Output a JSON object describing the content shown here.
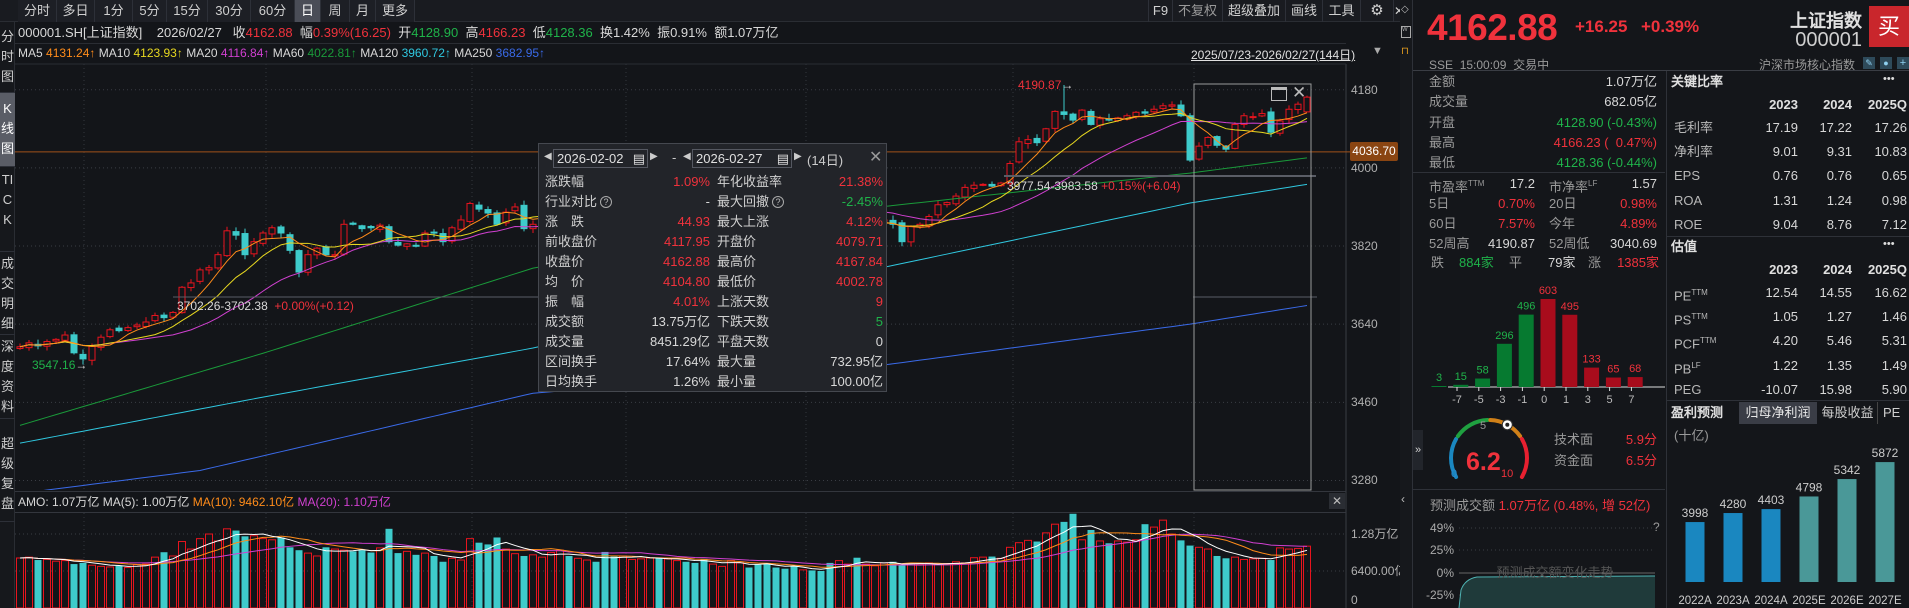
{
  "toolbar": {
    "tabs": [
      "分时",
      "多日",
      "1分",
      "5分",
      "15分",
      "30分",
      "60分",
      "日",
      "周",
      "月",
      "更多"
    ],
    "active_tab": "日",
    "right": [
      "F9",
      "不复权",
      "超级叠加",
      "画线",
      "工具"
    ]
  },
  "left_tabs": [
    "分时图",
    "K线图",
    "TICK",
    "成交明细",
    "深度资料",
    "超级复盘"
  ],
  "info": {
    "code": "000001.SH[上证指数]",
    "date": "2026/02/27",
    "close_label": "收",
    "close": "4162.88",
    "chg_label": "幅",
    "chg": "0.39%(16.25)",
    "open_label": "开",
    "open": "4128.90",
    "high_label": "高",
    "high": "4166.23",
    "low_label": "低",
    "low": "4128.36",
    "turnover": "换1.42%",
    "amplitude": "振0.91%",
    "amount": "额1.07万亿"
  },
  "ma": [
    {
      "label": "MA5",
      "value": "4131.24↑",
      "color": "#ff8c1a"
    },
    {
      "label": "MA10",
      "value": "4123.93↑",
      "color": "#e8d820"
    },
    {
      "label": "MA20",
      "value": "4116.84↑",
      "color": "#d040d0"
    },
    {
      "label": "MA60",
      "value": "4022.81↑",
      "color": "#1a9a3a"
    },
    {
      "label": "MA120",
      "value": "3960.72↑",
      "color": "#30c8e0"
    },
    {
      "label": "MA250",
      "value": "3682.95↑",
      "color": "#3a6ae8"
    }
  ],
  "date_range": "2025/07/23-2026/02/27(144日)",
  "price_axis": {
    "ticks": [
      4180,
      4000,
      3820,
      3640,
      3460,
      3280
    ],
    "ref_line": "4036.70"
  },
  "annotations": {
    "high_label": "4190.87",
    "low_label": "3547.16",
    "measure1": {
      "range": "3702.26-3702.38",
      "chg": "+0.00%(+0.12)"
    },
    "measure2": {
      "range": "3977.54-3983.58",
      "chg": "+0.15%(+6.04)"
    }
  },
  "tooltip": {
    "start": "2026-02-02",
    "end": "2026-02-27",
    "sep": "-",
    "days": "(14日)",
    "rows": [
      {
        "l": "涨跌幅",
        "v": "1.09%",
        "c": "red",
        "l2": "年化收益率",
        "v2": "21.38%",
        "c2": "red"
      },
      {
        "l": "行业对比",
        "h": true,
        "v": "-",
        "c": "white",
        "l2": "最大回撤",
        "h2": true,
        "v2": "-2.45%",
        "c2": "green"
      },
      {
        "l": "涨　跌",
        "v": "44.93",
        "c": "red",
        "l2": "最大上涨",
        "v2": "4.12%",
        "c2": "red"
      },
      {
        "l": "前收盘价",
        "v": "4117.95",
        "c": "red",
        "l2": "开盘价",
        "v2": "4079.71",
        "c2": "red"
      },
      {
        "l": "收盘价",
        "v": "4162.88",
        "c": "red",
        "l2": "最高价",
        "v2": "4167.84",
        "c2": "red"
      },
      {
        "l": "均　价",
        "v": "4104.80",
        "c": "red",
        "l2": "最低价",
        "v2": "4002.78",
        "c2": "red"
      },
      {
        "l": "振　幅",
        "v": "4.01%",
        "c": "red",
        "l2": "上涨天数",
        "v2": "9",
        "c2": "red"
      },
      {
        "l": "成交额",
        "v": "13.75万亿",
        "c": "white",
        "l2": "下跌天数",
        "v2": "5",
        "c2": "green"
      },
      {
        "l": "成交量",
        "v": "8451.29亿",
        "c": "white",
        "l2": "平盘天数",
        "v2": "0",
        "c2": "white"
      },
      {
        "l": "区间换手",
        "v": "17.64%",
        "c": "white",
        "l2": "最大量",
        "v2": "732.95亿",
        "c2": "white"
      },
      {
        "l": "日均换手",
        "v": "1.26%",
        "c": "white",
        "l2": "最小量",
        "v2": "100.00亿",
        "c2": "white"
      }
    ]
  },
  "volume": {
    "amo": "AMO: 1.07万亿",
    "ma5": "MA(5): 1.00万亿",
    "ma10": "MA(10): 9462.10亿",
    "ma20": "MA(20): 1.10万亿",
    "ticks": [
      "1.28万亿",
      "6400.00亿",
      "0"
    ]
  },
  "kline": {
    "closes": [
      3588,
      3597,
      3590,
      3600,
      3605,
      3615,
      3574,
      3560,
      3589,
      3610,
      3627,
      3625,
      3632,
      3638,
      3645,
      3660,
      3655,
      3667,
      3725,
      3735,
      3765,
      3770,
      3800,
      3855,
      3845,
      3800,
      3830,
      3850,
      3862,
      3850,
      3810,
      3760,
      3800,
      3815,
      3800,
      3800,
      3870,
      3870,
      3860,
      3862,
      3868,
      3830,
      3822,
      3825,
      3820,
      3850,
      3850,
      3830,
      3862,
      3880,
      3918,
      3905,
      3896,
      3870,
      3898,
      3910,
      3860,
      3870,
      3882,
      3890,
      3900,
      3895,
      3905,
      3910,
      3898,
      3888,
      3880,
      3892,
      3902,
      3915,
      3925,
      3918,
      3930,
      3940,
      3935,
      3925,
      3912,
      3920,
      3932,
      3945,
      3950,
      3938,
      3925,
      3915,
      3905,
      3898,
      3890,
      3900,
      3885,
      3870,
      3860,
      3868,
      3875,
      3862,
      3870,
      3878,
      3880,
      3870,
      3830,
      3865,
      3870,
      3888,
      3915,
      3920,
      3935,
      3955,
      3960,
      3962,
      3958,
      3965,
      4010,
      4060,
      4065,
      4058,
      4090,
      4130,
      4123,
      4110,
      4133,
      4100,
      4113,
      4110,
      4115,
      4120,
      4128,
      4126,
      4135,
      4143,
      4145,
      4120,
      4018,
      4050,
      4070,
      4052,
      4043,
      4100,
      4120,
      4118,
      4125,
      4082,
      4108,
      4135,
      4146.63,
      4162.88
    ],
    "volumes": [
      8650,
      8800,
      8300,
      8400,
      8100,
      8200,
      7600,
      7800,
      7400,
      7200,
      7100,
      7300,
      7000,
      7500,
      7600,
      8800,
      9650,
      9000,
      11500,
      10200,
      12000,
      12800,
      11600,
      13700,
      13400,
      12400,
      12500,
      12000,
      11800,
      12200,
      10500,
      10000,
      9500,
      9000,
      10500,
      10200,
      10000,
      9800,
      10000,
      9600,
      10400,
      13700,
      9500,
      9800,
      9200,
      9500,
      9000,
      8000,
      8600,
      8300,
      12000,
      11300,
      11000,
      12200,
      10200,
      9400,
      9000,
      9200,
      8800,
      9600,
      10000,
      9000,
      8600,
      8300,
      8000,
      9700,
      8900,
      9000,
      8400,
      8500,
      8650,
      8600,
      8500,
      8200,
      8000,
      7800,
      8500,
      7600,
      7200,
      8200,
      7800,
      7000,
      7500,
      7800,
      7000,
      6800,
      7200,
      6600,
      6500,
      6400,
      7800,
      8200,
      7600,
      8700,
      7600,
      7300,
      7800,
      8000,
      7400,
      7700,
      7500,
      7800,
      7600,
      7700,
      8000,
      7800,
      8700,
      8800,
      8900,
      8600,
      10500,
      11300,
      11700,
      11500,
      13000,
      14500,
      14900,
      16300,
      11800,
      13500,
      11600,
      11200,
      11600,
      11400,
      11800,
      14500,
      14000,
      15200,
      12800,
      11700,
      10800,
      10500,
      10200,
      9000,
      8600,
      8800,
      8400,
      8500,
      8600,
      8300,
      10400,
      10200,
      10300,
      10700
    ],
    "last": {
      "open": 4128.9,
      "high": 4166.23,
      "low": 4128.36
    },
    "period_high": {
      "index": 116,
      "value": 4190.87
    },
    "period_low": {
      "index": 7,
      "value": 3547.16
    },
    "ma_long": {
      "ma60": [
        [
          0,
          3407
        ],
        [
          27,
          3573
        ],
        [
          57,
          3769
        ],
        [
          96,
          3911
        ],
        [
          130,
          3988
        ],
        [
          143,
          4023
        ]
      ],
      "ma120": [
        [
          0,
          3366
        ],
        [
          27,
          3472
        ],
        [
          57,
          3585
        ],
        [
          96,
          3771
        ],
        [
          130,
          3919
        ],
        [
          143,
          3962
        ]
      ],
      "ma250": [
        [
          0,
          3250
        ],
        [
          20,
          3303
        ],
        [
          57,
          3481
        ],
        [
          96,
          3546
        ],
        [
          130,
          3640
        ],
        [
          143,
          3683
        ]
      ]
    }
  },
  "quote": {
    "price": "4162.88",
    "change": "+16.25",
    "pct": "+0.39%",
    "name": "上证指数",
    "code": "000001",
    "buy": "买",
    "exchange": "SSE",
    "time": "15:00:09",
    "status": "交易中",
    "category": "沪深市场核心指数",
    "stats": [
      {
        "l": "金额",
        "v": "1.07万亿",
        "c": "white"
      },
      {
        "l": "成交量",
        "v": "682.05亿",
        "c": "white"
      },
      {
        "l": "开盘",
        "v": "4128.90 (-0.43%)",
        "c": "green"
      },
      {
        "l": "最高",
        "v": "4166.23 (  0.47%)",
        "c": "red"
      },
      {
        "l": "最低",
        "v": "4128.36 (-0.44%)",
        "c": "green"
      }
    ],
    "grid": [
      {
        "l": "市盈率",
        "sup": "TTM",
        "v": "17.2",
        "c": "white",
        "l2": "市净率",
        "sup2": "LF",
        "v2": "1.57",
        "c2": "white"
      },
      {
        "l": "5日",
        "v": "0.70%",
        "c": "red",
        "l2": "20日",
        "v2": "0.98%",
        "c2": "red"
      },
      {
        "l": "60日",
        "v": "7.57%",
        "c": "red",
        "l2": "今年",
        "v2": "4.89%",
        "c2": "red"
      },
      {
        "l": "52周高",
        "v": "4190.87",
        "c": "white",
        "l2": "52周低",
        "v2": "3040.69",
        "c2": "white"
      }
    ],
    "breadth": {
      "down_label": "跌",
      "down": "884家",
      "flat_label": "平",
      "flat": "79家",
      "up_label": "涨",
      "up": "1385家"
    }
  },
  "distribution": {
    "values": [
      3,
      15,
      58,
      296,
      496,
      603,
      495,
      133,
      65,
      68
    ],
    "colors": [
      "green",
      "green",
      "green",
      "green",
      "green",
      "red",
      "red",
      "red",
      "red",
      "red"
    ],
    "ticks": [
      "-7",
      "-5",
      "-3",
      "-1",
      "0",
      "1",
      "3",
      "5",
      "7"
    ]
  },
  "score": {
    "value": 6.2,
    "display": "6.2",
    "min": "0",
    "mid": "5",
    "max": "10",
    "tech_label": "技术面",
    "tech": "5.9分",
    "fund_label": "资金面",
    "fund": "6.5分"
  },
  "forecast_amount": {
    "label": "预测成交额",
    "value": "1.07万亿 (0.48%, 增 52亿)",
    "ticks": [
      "49%",
      "25%",
      "0%",
      "-25%"
    ],
    "help": "?",
    "watermark": "预测成交额变化走势"
  },
  "ratios": {
    "title": "关键比率",
    "more": "•••",
    "years": [
      "2023",
      "2024",
      "2025Q"
    ],
    "rows": [
      {
        "l": "毛利率",
        "v": [
          "17.19",
          "17.22",
          "17.26"
        ]
      },
      {
        "l": "净利率",
        "v": [
          "9.01",
          "9.31",
          "10.83"
        ]
      },
      {
        "l": "EPS",
        "v": [
          "0.76",
          "0.76",
          "0.65"
        ]
      },
      {
        "l": "ROA",
        "v": [
          "1.31",
          "1.24",
          "0.98"
        ]
      },
      {
        "l": "ROE",
        "v": [
          "9.04",
          "8.76",
          "7.12"
        ]
      }
    ]
  },
  "valuation": {
    "title": "估值",
    "more": "•••",
    "years": [
      "2023",
      "2024",
      "2025Q"
    ],
    "rows": [
      {
        "l": "PE",
        "sup": "TTM",
        "v": [
          "12.54",
          "14.55",
          "16.62"
        ]
      },
      {
        "l": "PS",
        "sup": "TTM",
        "v": [
          "1.05",
          "1.27",
          "1.46"
        ]
      },
      {
        "l": "PCF",
        "sup": "TTM",
        "v": [
          "4.20",
          "5.46",
          "5.31"
        ]
      },
      {
        "l": "PB",
        "sup": "LF",
        "v": [
          "1.22",
          "1.35",
          "1.49"
        ]
      },
      {
        "l": "PEG",
        "v": [
          "-10.07",
          "15.98",
          "5.90"
        ]
      }
    ]
  },
  "earnings": {
    "title": "盈利预测",
    "tabs": [
      "归母净利润",
      "每股收益",
      "PE"
    ],
    "unit": "(十亿)",
    "bars": [
      {
        "year": "2022A",
        "value": 3998,
        "kind": "actual"
      },
      {
        "year": "2023A",
        "value": 4280,
        "kind": "actual"
      },
      {
        "year": "2024A",
        "value": 4403,
        "kind": "actual"
      },
      {
        "year": "2025E",
        "value": 4798,
        "kind": "estimate"
      },
      {
        "year": "2026E",
        "value": 5342,
        "kind": "estimate"
      },
      {
        "year": "2027E",
        "value": 5872,
        "kind": "estimate"
      }
    ],
    "colors": {
      "actual": "#1a87c0",
      "estimate": "#4a9898"
    }
  },
  "colors": {
    "up": "#e8141e",
    "down": "#3ecbcb",
    "red_text": "#f0323c",
    "green_text": "#1fb34a"
  }
}
